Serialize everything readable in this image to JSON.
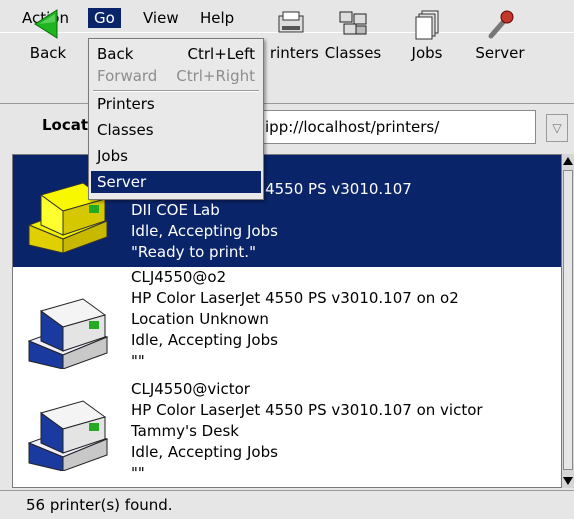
{
  "menubar": {
    "items": [
      {
        "label": "Action"
      },
      {
        "label": "Go"
      },
      {
        "label": "View"
      },
      {
        "label": "Help"
      }
    ]
  },
  "toolbar": {
    "back_label": "Back",
    "printers_label": "Printers",
    "classes_label": "Classes",
    "jobs_label": "Jobs",
    "server_label": "Server"
  },
  "location": {
    "label": "Location:",
    "value": "ipp://localhost/printers/"
  },
  "go_menu": {
    "items": [
      {
        "label": "Back",
        "accelerator": "Ctrl+Left"
      },
      {
        "label": "Forward",
        "accelerator": "Ctrl+Right"
      },
      {
        "label": "Printers"
      },
      {
        "label": "Classes"
      },
      {
        "label": "Jobs"
      },
      {
        "label": "Server"
      }
    ]
  },
  "printers": [
    {
      "name": "",
      "model": "HP Color LaserJet 4550 PS v3010.107",
      "location": "DII COE Lab",
      "state": "Idle, Accepting Jobs",
      "message": "\"Ready to print.\""
    },
    {
      "name": "CLJ4550@o2",
      "model": "HP Color LaserJet 4550 PS v3010.107 on o2",
      "location": "Location Unknown",
      "state": "Idle, Accepting Jobs",
      "message": "\"\""
    },
    {
      "name": "CLJ4550@victor",
      "model": "HP Color LaserJet 4550 PS v3010.107 on victor",
      "location": "Tammy's Desk",
      "state": "Idle, Accepting Jobs",
      "message": "\"\""
    }
  ],
  "status": {
    "text": "56 printer(s) found."
  },
  "colors": {
    "selection": "#0a246a",
    "window_bg": "#e6e6e6"
  }
}
